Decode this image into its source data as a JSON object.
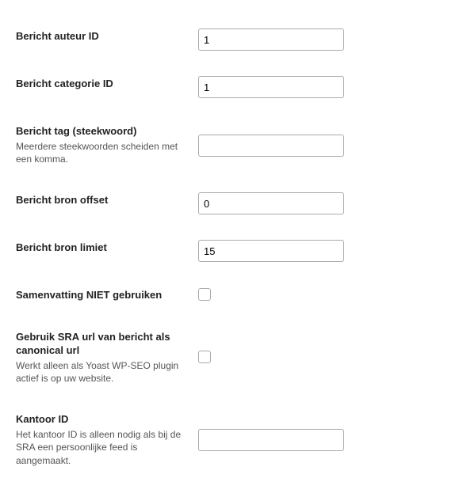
{
  "fields": {
    "author_id": {
      "label": "Bericht auteur ID",
      "value": "1"
    },
    "category_id": {
      "label": "Bericht categorie ID",
      "value": "1"
    },
    "tag": {
      "label": "Bericht tag (steekwoord)",
      "description": "Meerdere steekwoorden scheiden met een komma.",
      "value": ""
    },
    "source_offset": {
      "label": "Bericht bron offset",
      "value": "0"
    },
    "source_limit": {
      "label": "Bericht bron limiet",
      "value": "15"
    },
    "no_summary": {
      "label": "Samenvatting NIET gebruiken"
    },
    "sra_canonical": {
      "label": "Gebruik SRA url van bericht als canonical url",
      "description": "Werkt alleen als Yoast WP-SEO plugin actief is op uw website."
    },
    "office_id": {
      "label": "Kantoor ID",
      "description": "Het kantoor ID is alleen nodig als bij de SRA een persoonlijke feed is aangemaakt.",
      "value": ""
    }
  }
}
